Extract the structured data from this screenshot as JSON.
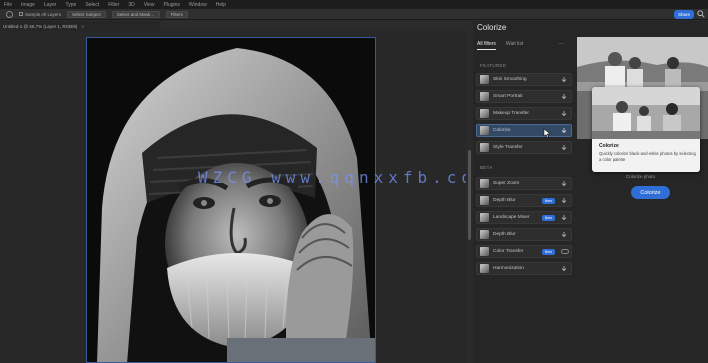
{
  "menubar": {
    "items": [
      "File",
      "Image",
      "Layer",
      "Type",
      "Select",
      "Filter",
      "3D",
      "View",
      "Plugins",
      "Window",
      "Help"
    ]
  },
  "options": {
    "checkbox_label": "Sample All Layers",
    "button_1": "Select Subject",
    "button_2": "Select and Mask…",
    "button_3": "Filters"
  },
  "header": {
    "share_label": "Share"
  },
  "document": {
    "tab_title": "Untitled-1 @ 66.7% (Layer 1, RGB/8)",
    "close": "×"
  },
  "watermark": "WZCG www.qqnxxfb.com",
  "panel": {
    "title": "Colorize",
    "tabs": [
      "All filters",
      "Wait list"
    ],
    "sections": {
      "featured": "FEATURED",
      "beta": "BETA"
    },
    "featured_items": [
      {
        "label": "Skin Smoothing",
        "selected": false
      },
      {
        "label": "Smart Portrait",
        "selected": false
      },
      {
        "label": "Makeup Transfer",
        "selected": false
      },
      {
        "label": "Colorize",
        "selected": true
      },
      {
        "label": "Style Transfer",
        "selected": false
      }
    ],
    "beta_items": [
      {
        "label": "Super Zoom",
        "badge": "",
        "toggle": false
      },
      {
        "label": "Depth Blur",
        "badge": "New",
        "toggle": false
      },
      {
        "label": "Landscape Mixer",
        "badge": "New",
        "toggle": false
      },
      {
        "label": "Depth Blur",
        "badge": "",
        "toggle": false
      },
      {
        "label": "Color Transfer",
        "badge": "New",
        "toggle": true
      },
      {
        "label": "Harmonization",
        "badge": "",
        "toggle": false
      }
    ]
  },
  "popover": {
    "title": "Colorize",
    "description": "Quickly colorize black-and-white photos by selecting a color palette",
    "caption": "Colorize photo"
  },
  "colorize_button": "Colorize",
  "colors": {
    "accent": "#2f6ed6",
    "panel_bg": "#262626",
    "selected_item": "#334a66",
    "watermark": "#7896ff"
  }
}
